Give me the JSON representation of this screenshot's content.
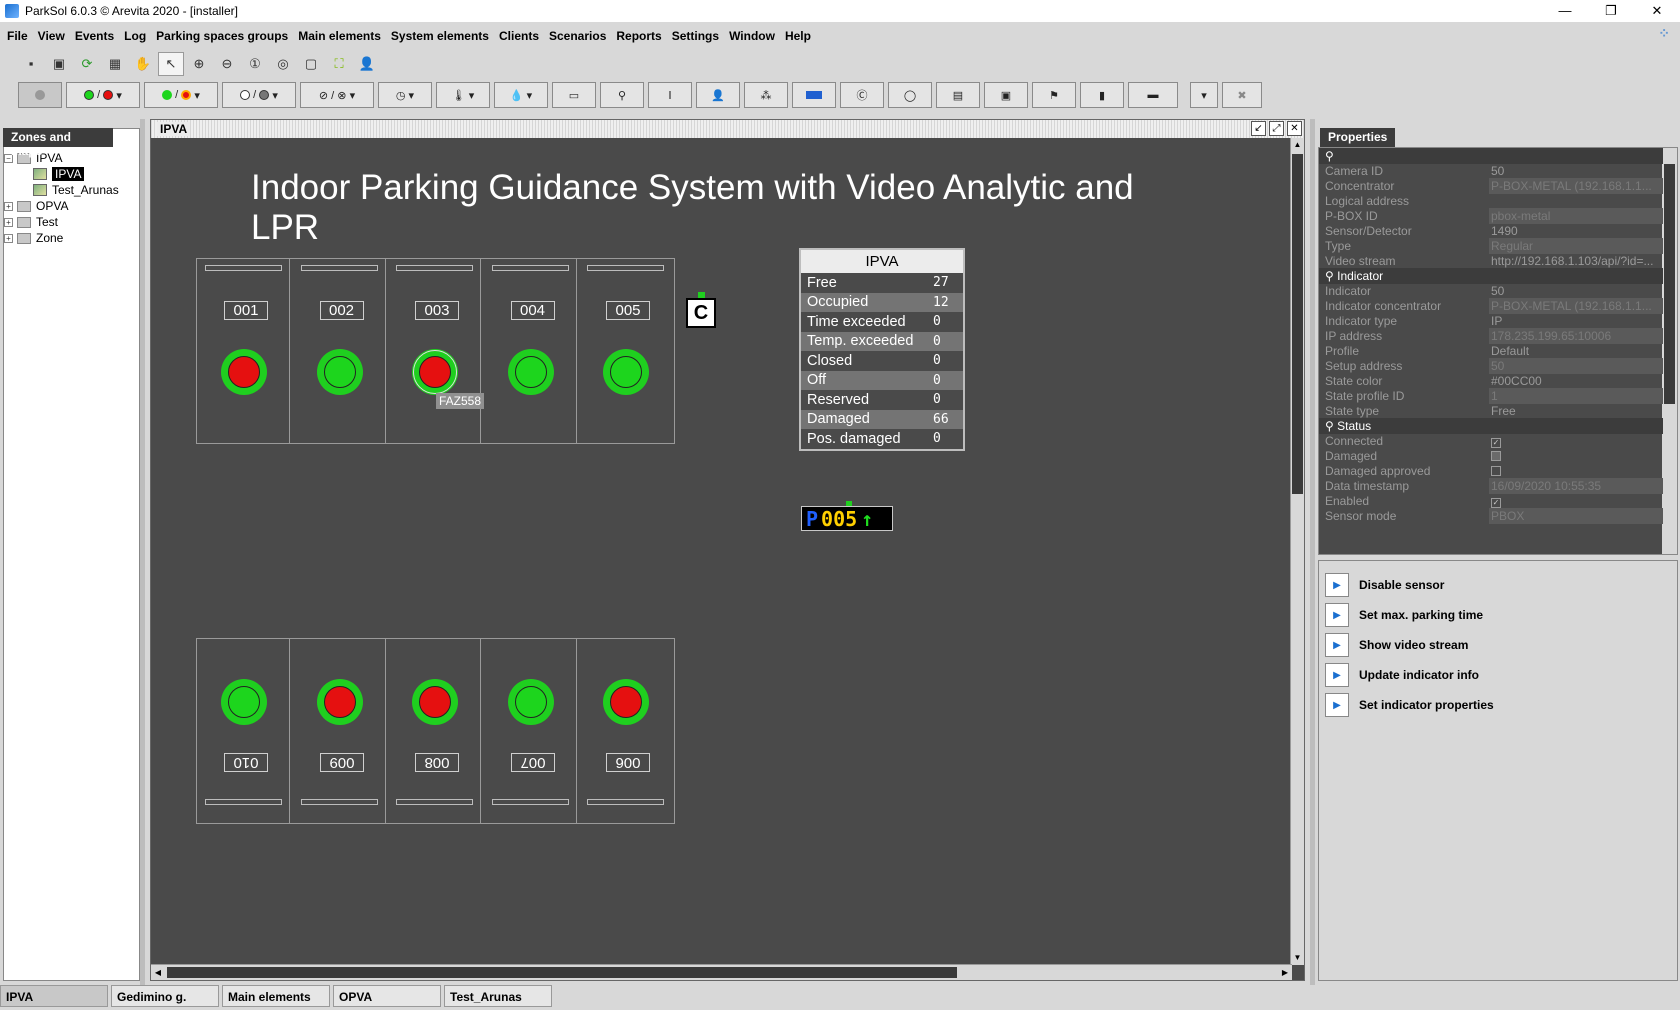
{
  "window": {
    "title": "ParkSol 6.0.3 © Arevita 2020 - [installer]"
  },
  "menu": [
    "File",
    "View",
    "Events",
    "Log",
    "Parking spaces groups",
    "Main elements",
    "System elements",
    "Clients",
    "Scenarios",
    "Reports",
    "Settings",
    "Window",
    "Help"
  ],
  "left_panel": {
    "tab": "Zones and maps",
    "tree": [
      {
        "label": "IPVA",
        "level": 0,
        "kind": "folder",
        "expander": "−"
      },
      {
        "label": "IPVA",
        "level": 1,
        "kind": "map",
        "selected": true
      },
      {
        "label": "Test_Arunas",
        "level": 1,
        "kind": "map"
      },
      {
        "label": "OPVA",
        "level": 0,
        "kind": "folder",
        "expander": "+"
      },
      {
        "label": "Test",
        "level": 0,
        "kind": "folder",
        "expander": "+"
      },
      {
        "label": "Zone",
        "level": 0,
        "kind": "folder",
        "expander": "+"
      }
    ]
  },
  "map": {
    "window_title": "IPVA",
    "heading": "Indoor Parking Guidance System with Video Analytic and LPR",
    "top_bays": [
      {
        "number": "001",
        "state": "occupied"
      },
      {
        "number": "002",
        "state": "free"
      },
      {
        "number": "003",
        "state": "occupied",
        "selected": true,
        "plate": "FAZ558"
      },
      {
        "number": "004",
        "state": "free"
      },
      {
        "number": "005",
        "state": "free"
      }
    ],
    "bottom_bays": [
      {
        "number": "010",
        "state": "free"
      },
      {
        "number": "009",
        "state": "occupied"
      },
      {
        "number": "008",
        "state": "occupied"
      },
      {
        "number": "007",
        "state": "free"
      },
      {
        "number": "006",
        "state": "occupied"
      }
    ],
    "concentrator_label": "C",
    "stats": {
      "title": "IPVA",
      "rows": [
        {
          "label": "Free",
          "value": "27"
        },
        {
          "label": "Occupied",
          "value": "12"
        },
        {
          "label": "Time exceeded",
          "value": "0"
        },
        {
          "label": "Temp. exceeded",
          "value": "0"
        },
        {
          "label": "Closed",
          "value": "0"
        },
        {
          "label": "Off",
          "value": "0"
        },
        {
          "label": "Reserved",
          "value": "0"
        },
        {
          "label": "Damaged",
          "value": "66"
        },
        {
          "label": "Pos. damaged",
          "value": "0"
        }
      ]
    },
    "display": {
      "prefix": "P",
      "count": "005",
      "arrow": "↑"
    }
  },
  "properties": {
    "tab": "Properties",
    "rows": [
      {
        "key": "",
        "value": "",
        "section": true
      },
      {
        "key": "Camera ID",
        "value": "50"
      },
      {
        "key": "Concentrator",
        "value": "P-BOX-METAL (192.168.1.1...",
        "boxed": true
      },
      {
        "key": "Logical address",
        "value": ""
      },
      {
        "key": "P-BOX ID",
        "value": "pbox-metal",
        "boxed": true
      },
      {
        "key": "Sensor/Detector",
        "value": "1490"
      },
      {
        "key": "Type",
        "value": "Regular",
        "boxed": true
      },
      {
        "key": "Video stream",
        "value": "http://192.168.1.103/api/?id=..."
      },
      {
        "key": "Indicator",
        "value": "",
        "section": true
      },
      {
        "key": "Indicator",
        "value": "50"
      },
      {
        "key": "Indicator concentrator",
        "value": "P-BOX-METAL (192.168.1.1...",
        "boxed": true
      },
      {
        "key": "Indicator type",
        "value": "IP"
      },
      {
        "key": "IP address",
        "value": "178.235.199.65:10006",
        "boxed": true
      },
      {
        "key": "Profile",
        "value": "Default"
      },
      {
        "key": "Setup address",
        "value": "50",
        "boxed": true
      },
      {
        "key": "State color",
        "value": "#00CC00"
      },
      {
        "key": "State profile ID",
        "value": "1",
        "boxed": true
      },
      {
        "key": "State type",
        "value": "Free"
      },
      {
        "key": "Status",
        "value": "",
        "section": true
      },
      {
        "key": "Connected",
        "value": "",
        "check": "on"
      },
      {
        "key": "Damaged",
        "value": "",
        "check": "gray"
      },
      {
        "key": "Damaged approved",
        "value": "",
        "check": "off"
      },
      {
        "key": "Data timestamp",
        "value": "16/09/2020 10:55:35",
        "boxed": true
      },
      {
        "key": "Enabled",
        "value": "",
        "check": "on"
      },
      {
        "key": "Sensor mode",
        "value": "PBOX",
        "boxed": true
      }
    ]
  },
  "actions": [
    "Disable sensor",
    "Set max. parking time",
    "Show video stream",
    "Update indicator info",
    "Set indicator properties"
  ],
  "bottom_tabs": [
    "IPVA",
    "Gedimino g.",
    "Main elements",
    "OPVA",
    "Test_Arunas"
  ],
  "colors": {
    "free": "#1dd51d",
    "occupied": "#e51010",
    "ring": "#1fcf1f",
    "canvas": "#4a4a4a"
  }
}
